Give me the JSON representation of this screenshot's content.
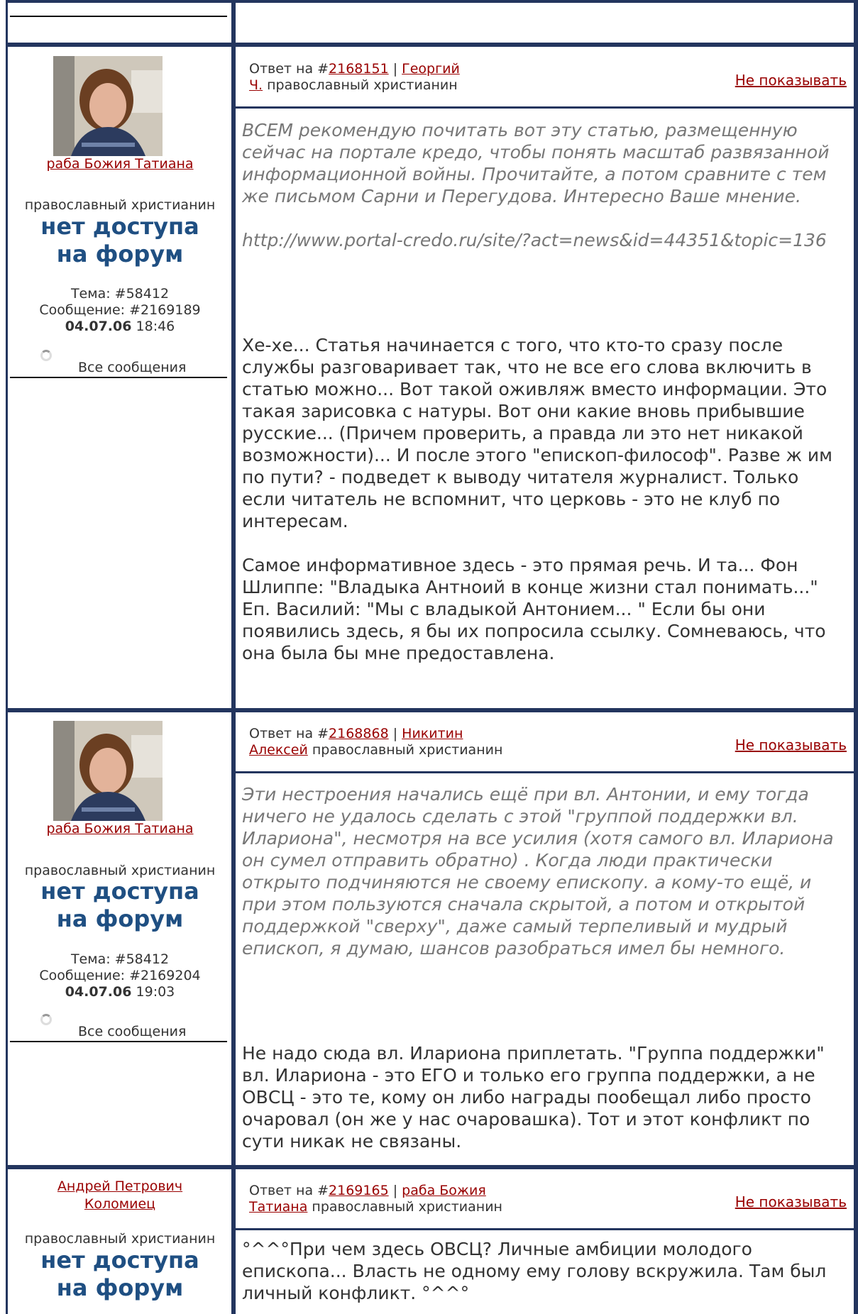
{
  "posts": [
    {
      "author": "раба Божия Татиана",
      "role": "православный христианин",
      "access": [
        "нет доступа",
        "на форум"
      ],
      "topic": "Тема: #58412",
      "message": "Сообщение: #2169189",
      "date": "04.07.06",
      "time": "18:46",
      "all_messages": "Все сообщения",
      "reply_prefix": "Ответ на #",
      "reply_to_id": "2168151",
      "reply_author_line1": "Георгий",
      "reply_author_line2": "Ч.",
      "reply_role": "православный христианин",
      "hide": "Не показывать",
      "quote": [
        "ВСЕМ рекомендую почитать вот эту статью, размещенную сейчас на портале кредо, чтобы понять масштаб развязанной информационной войны. Прочитайте, а потом сравните с тем же письмом Сарни и Перегудова. Интересно Ваше мнение.",
        "http://www.portal-credo.ru/site/?act=news&id=44351&topic=136"
      ],
      "body": [
        "Хе-хе... Статья начинается с того, что кто-то сразу после службы разговаривает так, что не все его слова включить в статью можно... Вот такой оживляж вместо информации. Это такая зарисовка с натуры. Вот они какие вновь прибывшие русские... (Причем проверить, а правда ли это нет никакой возможности)... И после этого \"епископ-философ\". Разве ж им по пути? - подведет к выводу читателя журналист. Только если читатель не вспомнит, что церковь - это не клуб по интересам.",
        "Самое информативное здесь - это прямая речь. И та... Фон Шлиппе: \"Владыка Антноий в конце жизни стал понимать...\" Еп. Василий: \"Мы с владыкой Антонием... \" Если бы они появились здесь, я бы их попросила ссылку. Сомневаюсь, что она была бы мне предоставлена."
      ]
    },
    {
      "author": "раба Божия Татиана",
      "role": "православный христианин",
      "access": [
        "нет доступа",
        "на форум"
      ],
      "topic": "Тема: #58412",
      "message": "Сообщение: #2169204",
      "date": "04.07.06",
      "time": "19:03",
      "all_messages": "Все сообщения",
      "reply_prefix": "Ответ на #",
      "reply_to_id": "2168868",
      "reply_author_line1": "Никитин",
      "reply_author_line2": "Алексей",
      "reply_role": "православный христианин",
      "hide": "Не показывать",
      "quote": [
        "Эти нестроения начались ещё при вл. Антонии, и ему тогда ничего не удалось сделать с этой \"группой поддержки вл. Илариона\", несмотря на все усилия (хотя самого вл. Илариона он сумел отправить обратно) . Когда люди практически открыто подчиняются не своему епископу. а кому-то ещё, и при этом пользуются сначала скрытой, а потом и открытой поддержкой \"сверху\", даже самый терпеливый и мудрый епископ, я думаю, шансов разобраться имел бы немного."
      ],
      "body": [
        "Не надо сюда вл. Илариона приплетать. \"Группа поддержки\" вл. Илариона - это ЕГО и только его группа поддержки, а не ОВСЦ - это те, кому он либо награды пообещал либо просто очаровал (он же у нас очаровашка). Тот и этот конфликт по сути никак не связаны."
      ]
    },
    {
      "author_line1": "Андрей Петрович",
      "author_line2": "Коломиец",
      "role": "православный христианин",
      "access": [
        "нет доступа",
        "на форум"
      ],
      "reply_prefix": "Ответ на #",
      "reply_to_id": "2169165",
      "reply_author_line1": "раба Божия",
      "reply_author_line2": "Татиана",
      "reply_role": "православный христианин",
      "hide": "Не показывать",
      "body": [
        "°^^°При чем здесь ОВСЦ? Личные амбиции молодого епископа... Власть не одному ему голову вскружила. Там был личный конфликт. °^^°"
      ]
    }
  ]
}
